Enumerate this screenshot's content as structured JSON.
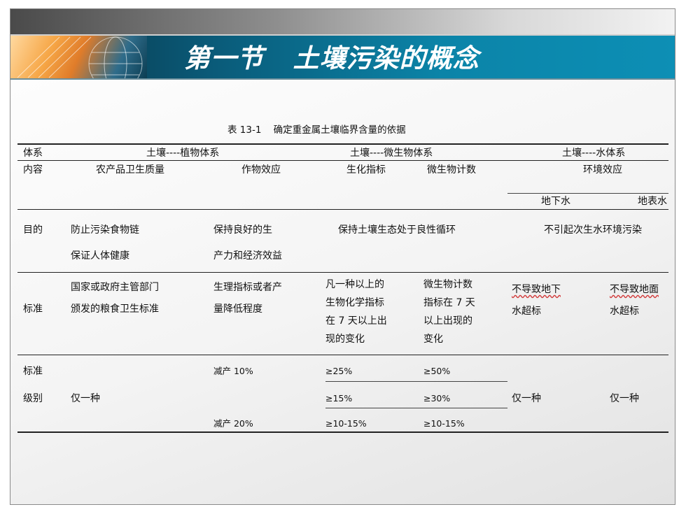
{
  "slide": {
    "title": "第一节   土壤污染的概念",
    "caption": "表 13-1    确定重金属土壤临界含量的依据"
  },
  "table": {
    "r1": {
      "c0": "体系",
      "soil_plant": "土壤----植物体系",
      "soil_micro": "土壤----微生物体系",
      "soil_water": "土壤----水体系"
    },
    "r2": {
      "c0": "内容",
      "agri": "农产品卫生质量",
      "crop": "作物效应",
      "biochem": "生化指标",
      "microcount": "微生物计数",
      "env": "环境效应"
    },
    "r3": {
      "ground": "地下水",
      "surface": "地表水"
    },
    "r4": {
      "c0": "目的",
      "agri": [
        "防止污染食物链",
        "保证人体健康"
      ],
      "crop": [
        "保持良好的生",
        "产力和经济效益"
      ],
      "micro": "保持土壤生态处于良性循环",
      "water": "不引起次生水环境污染"
    },
    "r5": {
      "c0": "标准",
      "agri": [
        "国家或政府主管部门",
        "颁发的粮食卫生标准"
      ],
      "crop": [
        "生理指标或者产",
        "量降低程度"
      ],
      "biochem": [
        "凡一种以上的",
        "生物化学指标",
        "在 7 天以上出",
        "现的变化"
      ],
      "microcount": [
        "微生物计数",
        "指标在 7 天",
        "以上出现的",
        "变化"
      ],
      "ground": [
        "不导致地下",
        "水超标"
      ],
      "surface": [
        "不导致地面",
        "水超标"
      ]
    },
    "r6": {
      "c0": [
        "标准",
        "级别"
      ],
      "agri": "仅一种",
      "crop": [
        "减产 10%",
        "减产 20%"
      ],
      "biochem": [
        "≥25%",
        "≥15%",
        "≥10-15%"
      ],
      "microcount": [
        "≥50%",
        "≥30%",
        "≥10-15%"
      ],
      "ground": "仅一种",
      "surface": "仅一种"
    }
  }
}
